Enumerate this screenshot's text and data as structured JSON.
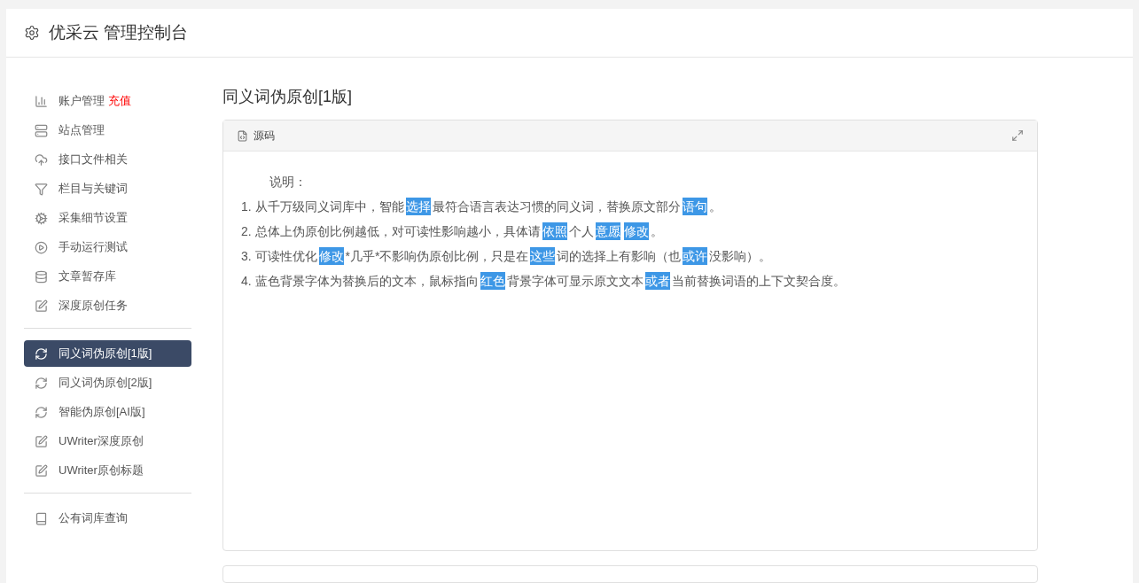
{
  "header": {
    "title": "优采云 管理控制台"
  },
  "sidebar": {
    "groups": [
      {
        "items": [
          {
            "label": "账户管理",
            "badge": "充值",
            "selected": false
          },
          {
            "label": "站点管理",
            "selected": false
          },
          {
            "label": "接口文件相关",
            "selected": false
          },
          {
            "label": "栏目与关键词",
            "selected": false
          },
          {
            "label": "采集细节设置",
            "selected": false
          },
          {
            "label": "手动运行测试",
            "selected": false
          },
          {
            "label": "文章暂存库",
            "selected": false
          },
          {
            "label": "深度原创任务",
            "selected": false
          }
        ]
      },
      {
        "items": [
          {
            "label": "同义词伪原创[1版]",
            "selected": true
          },
          {
            "label": "同义词伪原创[2版]",
            "selected": false
          },
          {
            "label": "智能伪原创[AI版]",
            "selected": false
          },
          {
            "label": "UWriter深度原创",
            "selected": false
          },
          {
            "label": "UWriter原创标题",
            "selected": false
          }
        ]
      },
      {
        "items": [
          {
            "label": "公有词库查询",
            "selected": false
          }
        ]
      }
    ]
  },
  "page": {
    "title": "同义词伪原创[1版]",
    "card": {
      "title": "源码",
      "intro": "说明：",
      "lines": [
        [
          {
            "text": "1. 从千万级同义词库中，智能",
            "highlighted": false
          },
          {
            "text": "选择",
            "highlighted": true
          },
          {
            "text": "最符合语言表达习惯的同义词，替换原文部分",
            "highlighted": false
          },
          {
            "text": "语句",
            "highlighted": true
          },
          {
            "text": "。",
            "highlighted": false
          }
        ],
        [
          {
            "text": "2. 总体上伪原创比例越低，对可读性影响越小，具体请",
            "highlighted": false
          },
          {
            "text": "依照",
            "highlighted": true
          },
          {
            "text": "个人",
            "highlighted": false
          },
          {
            "text": "意愿",
            "highlighted": true
          },
          {
            "text": "修改",
            "highlighted": true
          },
          {
            "text": "。",
            "highlighted": false
          }
        ],
        [
          {
            "text": "3. 可读性优化",
            "highlighted": false
          },
          {
            "text": "修改",
            "highlighted": true
          },
          {
            "text": "*几乎*不影响伪原创比例，只是在",
            "highlighted": false
          },
          {
            "text": "这些",
            "highlighted": true
          },
          {
            "text": "词的选择上有影响（也",
            "highlighted": false
          },
          {
            "text": "或许",
            "highlighted": true
          },
          {
            "text": "没影响）。",
            "highlighted": false
          }
        ],
        [
          {
            "text": "4. 蓝色背景字体为替换后的文本，鼠标指向",
            "highlighted": false
          },
          {
            "text": "红色",
            "highlighted": true
          },
          {
            "text": "背景字体可显示原文文本",
            "highlighted": false
          },
          {
            "text": "或者",
            "highlighted": true
          },
          {
            "text": "当前替换词语的上下文契合度。",
            "highlighted": false
          }
        ]
      ]
    }
  }
}
